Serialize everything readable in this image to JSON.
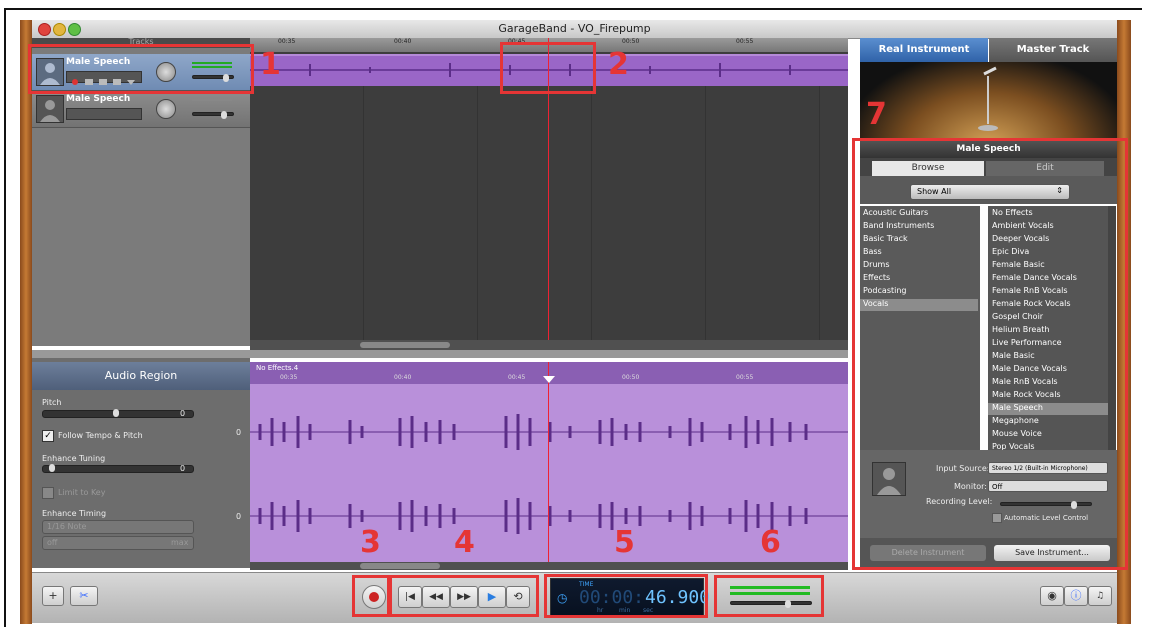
{
  "window": {
    "title": "GarageBand - VO_Firepump"
  },
  "tracks_header": "Tracks",
  "tracks": [
    {
      "name": "Male Speech",
      "selected": true
    },
    {
      "name": "Male Speech",
      "selected": false
    }
  ],
  "ruler": {
    "ticks": [
      "00:35",
      "00:40",
      "00:45",
      "00:50",
      "00:55"
    ]
  },
  "editor": {
    "panel_title": "Audio Region",
    "region_name": "No Effects.4",
    "pitch_label": "Pitch",
    "pitch_value": "0",
    "follow_tempo_label": "Follow Tempo & Pitch",
    "follow_tempo_checked": true,
    "enhance_tuning_label": "Enhance Tuning",
    "enhance_tuning_value": "0",
    "limit_key_label": "Limit to Key",
    "enhance_timing_label": "Enhance Timing",
    "timing_note": "1/16 Note",
    "timing_off": "off",
    "timing_max": "max",
    "lane_labels": [
      "0",
      "0"
    ]
  },
  "right_panel": {
    "tabs": [
      "Real Instrument",
      "Master Track"
    ],
    "instrument_name": "Male Speech",
    "browse_tabs": [
      "Browse",
      "Edit"
    ],
    "show_all": "Show All",
    "categories": [
      "Acoustic Guitars",
      "Band Instruments",
      "Basic Track",
      "Bass",
      "Drums",
      "Effects",
      "Podcasting",
      "Vocals"
    ],
    "selected_category": "Vocals",
    "presets": [
      "No Effects",
      "Ambient Vocals",
      "Deeper Vocals",
      "Epic Diva",
      "Female Basic",
      "Female Dance Vocals",
      "Female RnB Vocals",
      "Female Rock Vocals",
      "Gospel Choir",
      "Helium Breath",
      "Live Performance",
      "Male Basic",
      "Male Dance Vocals",
      "Male RnB Vocals",
      "Male Rock Vocals",
      "Male Speech",
      "Megaphone",
      "Mouse Voice",
      "Pop Vocals"
    ],
    "selected_preset": "Male Speech",
    "input_source_label": "Input Source:",
    "input_source_value": "Stereo 1/2 (Built-in Microphone)",
    "monitor_label": "Monitor:",
    "monitor_value": "Off",
    "recording_level_label": "Recording Level:",
    "auto_level_label": "Automatic Level Control",
    "delete_btn": "Delete Instrument",
    "save_btn": "Save Instrument..."
  },
  "transport": {
    "lcd_mode": "TIME",
    "lcd_time": "00:00:46.900",
    "lcd_dim": "00:00:",
    "lcd_bright": "46.900",
    "lcd_units": [
      "hr",
      "min",
      "sec"
    ]
  },
  "annotations": [
    "1",
    "2",
    "3",
    "4",
    "5",
    "6",
    "7"
  ],
  "colors": {
    "accent_red": "#e53535",
    "region_purple": "#9a66c7",
    "lcd_blue": "#3fa6ff"
  }
}
